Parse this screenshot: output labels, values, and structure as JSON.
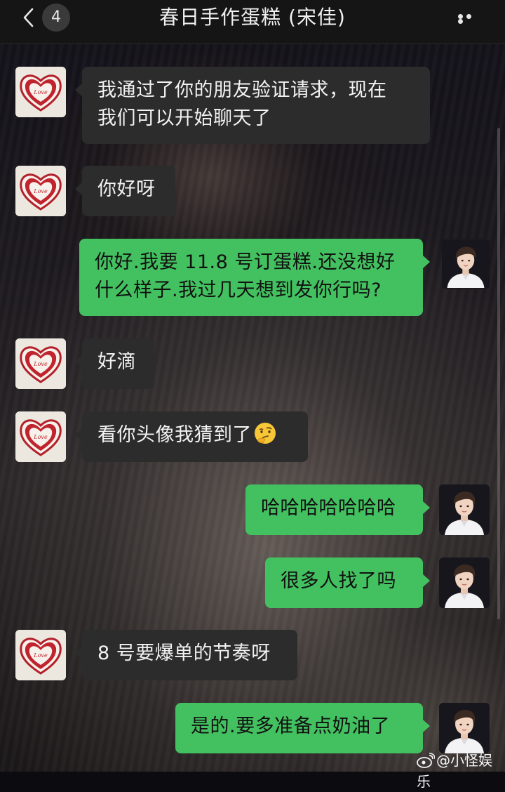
{
  "navbar": {
    "unread_count": "4",
    "title": "春日手作蛋糕 (宋佳)",
    "back_icon": "chevron-left-icon",
    "more_icon": "more-dots-icon"
  },
  "messages": [
    {
      "side": "in",
      "avatar": "heart-cake-avatar",
      "text_lines": [
        "我通过了你的朋友验证请求，现在",
        "我们可以开始聊天了"
      ]
    },
    {
      "side": "in",
      "avatar": "heart-cake-avatar",
      "text_lines": [
        "你好呀"
      ]
    },
    {
      "side": "out",
      "avatar": "boy-portrait-avatar",
      "text_lines": [
        "你好.我要 11.8 号订蛋糕.还没想好",
        "什么样子.我过几天想到发你行吗?"
      ]
    },
    {
      "side": "in",
      "avatar": "heart-cake-avatar",
      "text_lines": [
        "好滴"
      ]
    },
    {
      "side": "in",
      "avatar": "heart-cake-avatar",
      "text_lines": [
        "看你头像我猜到了"
      ],
      "trailing_emoji": "thinking-face-emoji"
    },
    {
      "side": "out",
      "avatar": "boy-portrait-avatar",
      "text_lines": [
        "哈哈哈哈哈哈哈"
      ]
    },
    {
      "side": "out",
      "avatar": "boy-portrait-avatar",
      "text_lines": [
        "很多人找了吗"
      ]
    },
    {
      "side": "in",
      "avatar": "heart-cake-avatar",
      "text_lines": [
        "8 号要爆单的节奏呀"
      ]
    },
    {
      "side": "out",
      "avatar": "boy-portrait-avatar",
      "text_lines": [
        "是的.要多准备点奶油了"
      ]
    }
  ],
  "watermark": {
    "text": "@小怪娱乐",
    "icon": "weibo-icon"
  },
  "colors": {
    "outgoing_bubble": "#43c160",
    "incoming_bubble": "#2c2c2c",
    "navbar": "#151515"
  }
}
